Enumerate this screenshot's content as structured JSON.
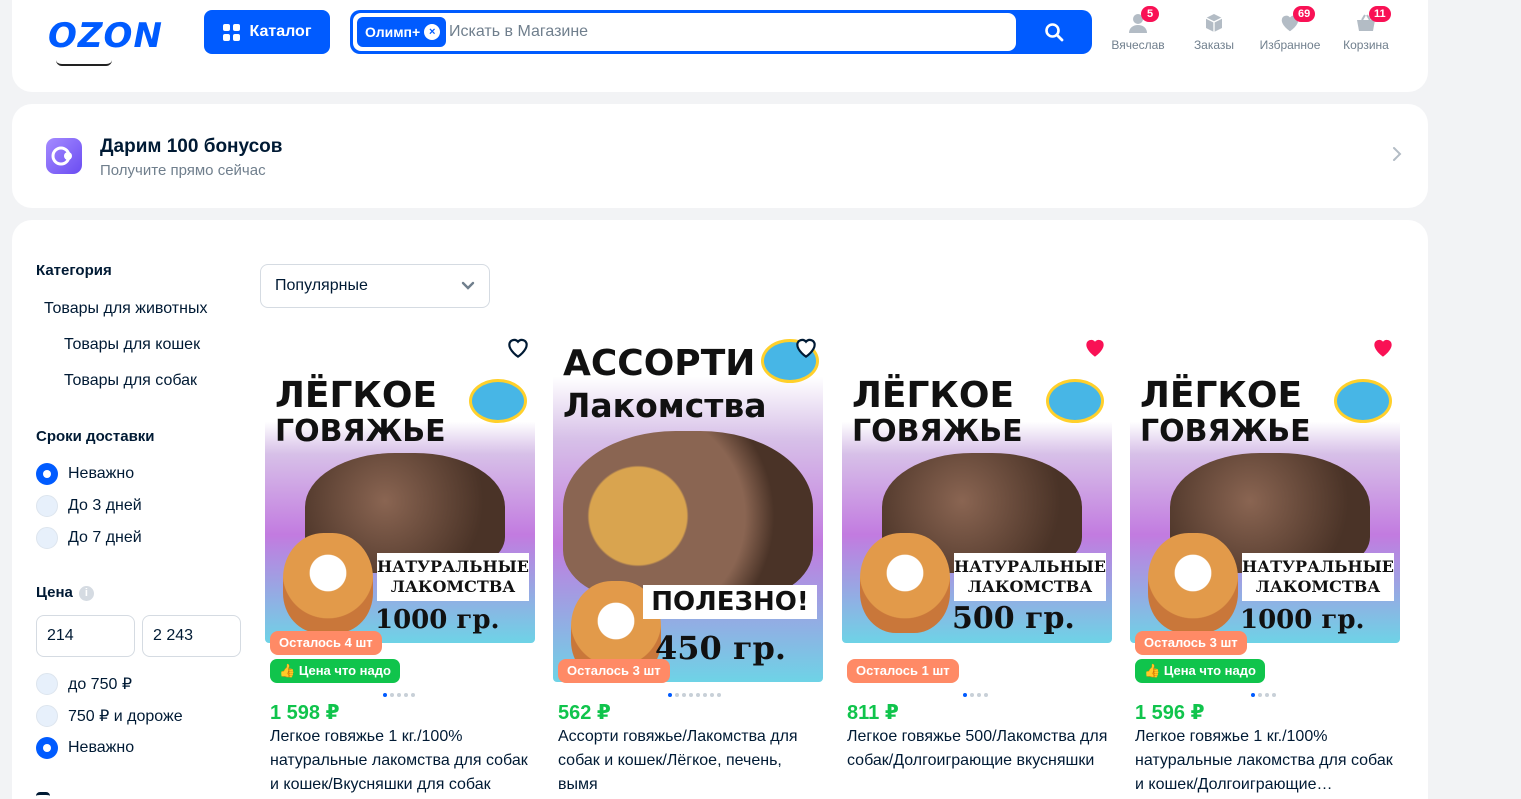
{
  "header": {
    "logo": "OZON",
    "catalog_label": "Каталог",
    "search_chip": "Олимп+",
    "search_placeholder": "Искать в Магазине",
    "nav": [
      {
        "label": "Вячеслав",
        "badge": "5",
        "icon": "user-icon"
      },
      {
        "label": "Заказы",
        "badge": "",
        "icon": "box-icon"
      },
      {
        "label": "Избранное",
        "badge": "69",
        "icon": "heart-icon"
      },
      {
        "label": "Корзина",
        "badge": "11",
        "icon": "cart-icon"
      }
    ]
  },
  "bonus": {
    "title": "Дарим 100 бонусов",
    "subtitle": "Получите прямо сейчас"
  },
  "filters": {
    "category_title": "Категория",
    "categories": [
      "Товары для животных",
      "Товары для кошек",
      "Товары для собак"
    ],
    "delivery_title": "Сроки доставки",
    "delivery_options": [
      {
        "label": "Неважно",
        "selected": true
      },
      {
        "label": "До 3 дней",
        "selected": false
      },
      {
        "label": "До 7 дней",
        "selected": false
      }
    ],
    "price_title": "Цена",
    "price_min": "214",
    "price_max": "2 243",
    "price_options": [
      {
        "label": "до 750 ₽",
        "selected": false
      },
      {
        "label": "750 ₽ и дороже",
        "selected": false
      },
      {
        "label": "Неважно",
        "selected": true
      }
    ]
  },
  "sort": {
    "selected": "Популярные"
  },
  "products": [
    {
      "image_title": "ЛЁГКОЕ\nГОВЯЖЬЕ",
      "image_label": "НАТУРАЛЬНЫЕ\nЛАКОМСТВА",
      "image_weight": "1000 гр.",
      "stock": "Осталось 4 шт",
      "badge": "Цена что надо",
      "favorite": false,
      "price": "1 598 ₽",
      "title": "Легкое говяжье 1 кг./100% натуральные лакомства для собак и кошек/Вкусняшки для собак"
    },
    {
      "image_title": "АССОРТИ\nЛакомства",
      "image_label": "ПОЛЕЗНО!",
      "image_weight": "450 гр.",
      "stock": "Осталось 3 шт",
      "badge": "",
      "favorite": false,
      "price": "562 ₽",
      "title": "Ассорти говяжье/Лакомства для собак и кошек/Лёгкое, печень, вымя"
    },
    {
      "image_title": "ЛЁГКОЕ\nГОВЯЖЬЕ",
      "image_label": "НАТУРАЛЬНЫЕ\nЛАКОМСТВА",
      "image_weight": "500 гр.",
      "stock": "Осталось 1 шт",
      "badge": "",
      "favorite": true,
      "price": "811 ₽",
      "title": "Легкое говяжье 500/Лакомства для собак/Долгоиграющие вкусняшки"
    },
    {
      "image_title": "ЛЁГКОЕ\nГОВЯЖЬЕ",
      "image_label": "НАТУРАЛЬНЫЕ\nЛАКОМСТВА",
      "image_weight": "1000 гр.",
      "stock": "Осталось 3 шт",
      "badge": "Цена что надо",
      "favorite": true,
      "price": "1 596 ₽",
      "title": "Легкое говяжье 1 кг./100% натуральные лакомства для собак и кошек/Долгоиграющие вкусняшки"
    }
  ],
  "colors": {
    "brand": "#005bff",
    "price": "#10c44c",
    "stock": "#ff8a66",
    "favorite": "#f91155"
  }
}
